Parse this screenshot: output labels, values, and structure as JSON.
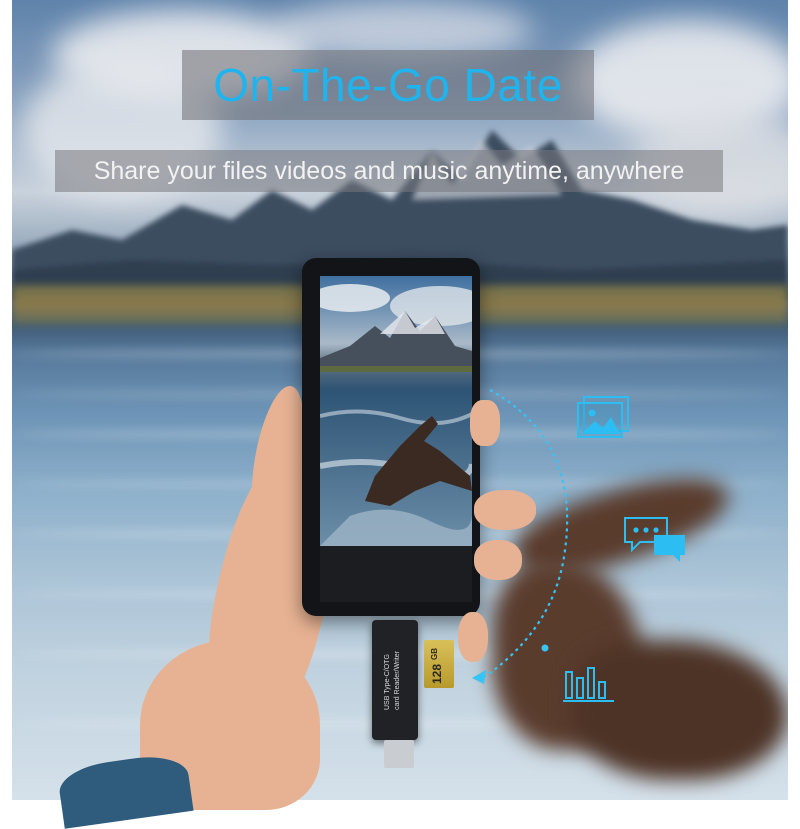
{
  "banner": {
    "title": "On-The-Go Date",
    "subtitle": "Share your files videos and music anytime, anywhere"
  },
  "device": {
    "reader_label_line1": "USB Type-C/OTG",
    "reader_label_line2": "card Reader/Writer",
    "card_capacity": "128",
    "card_unit": "GB"
  },
  "icons": [
    "image-icon",
    "chat-icon",
    "music-bars-icon"
  ],
  "colors": {
    "accent": "#1fb4ee",
    "banner_background": "#6e6e73"
  }
}
